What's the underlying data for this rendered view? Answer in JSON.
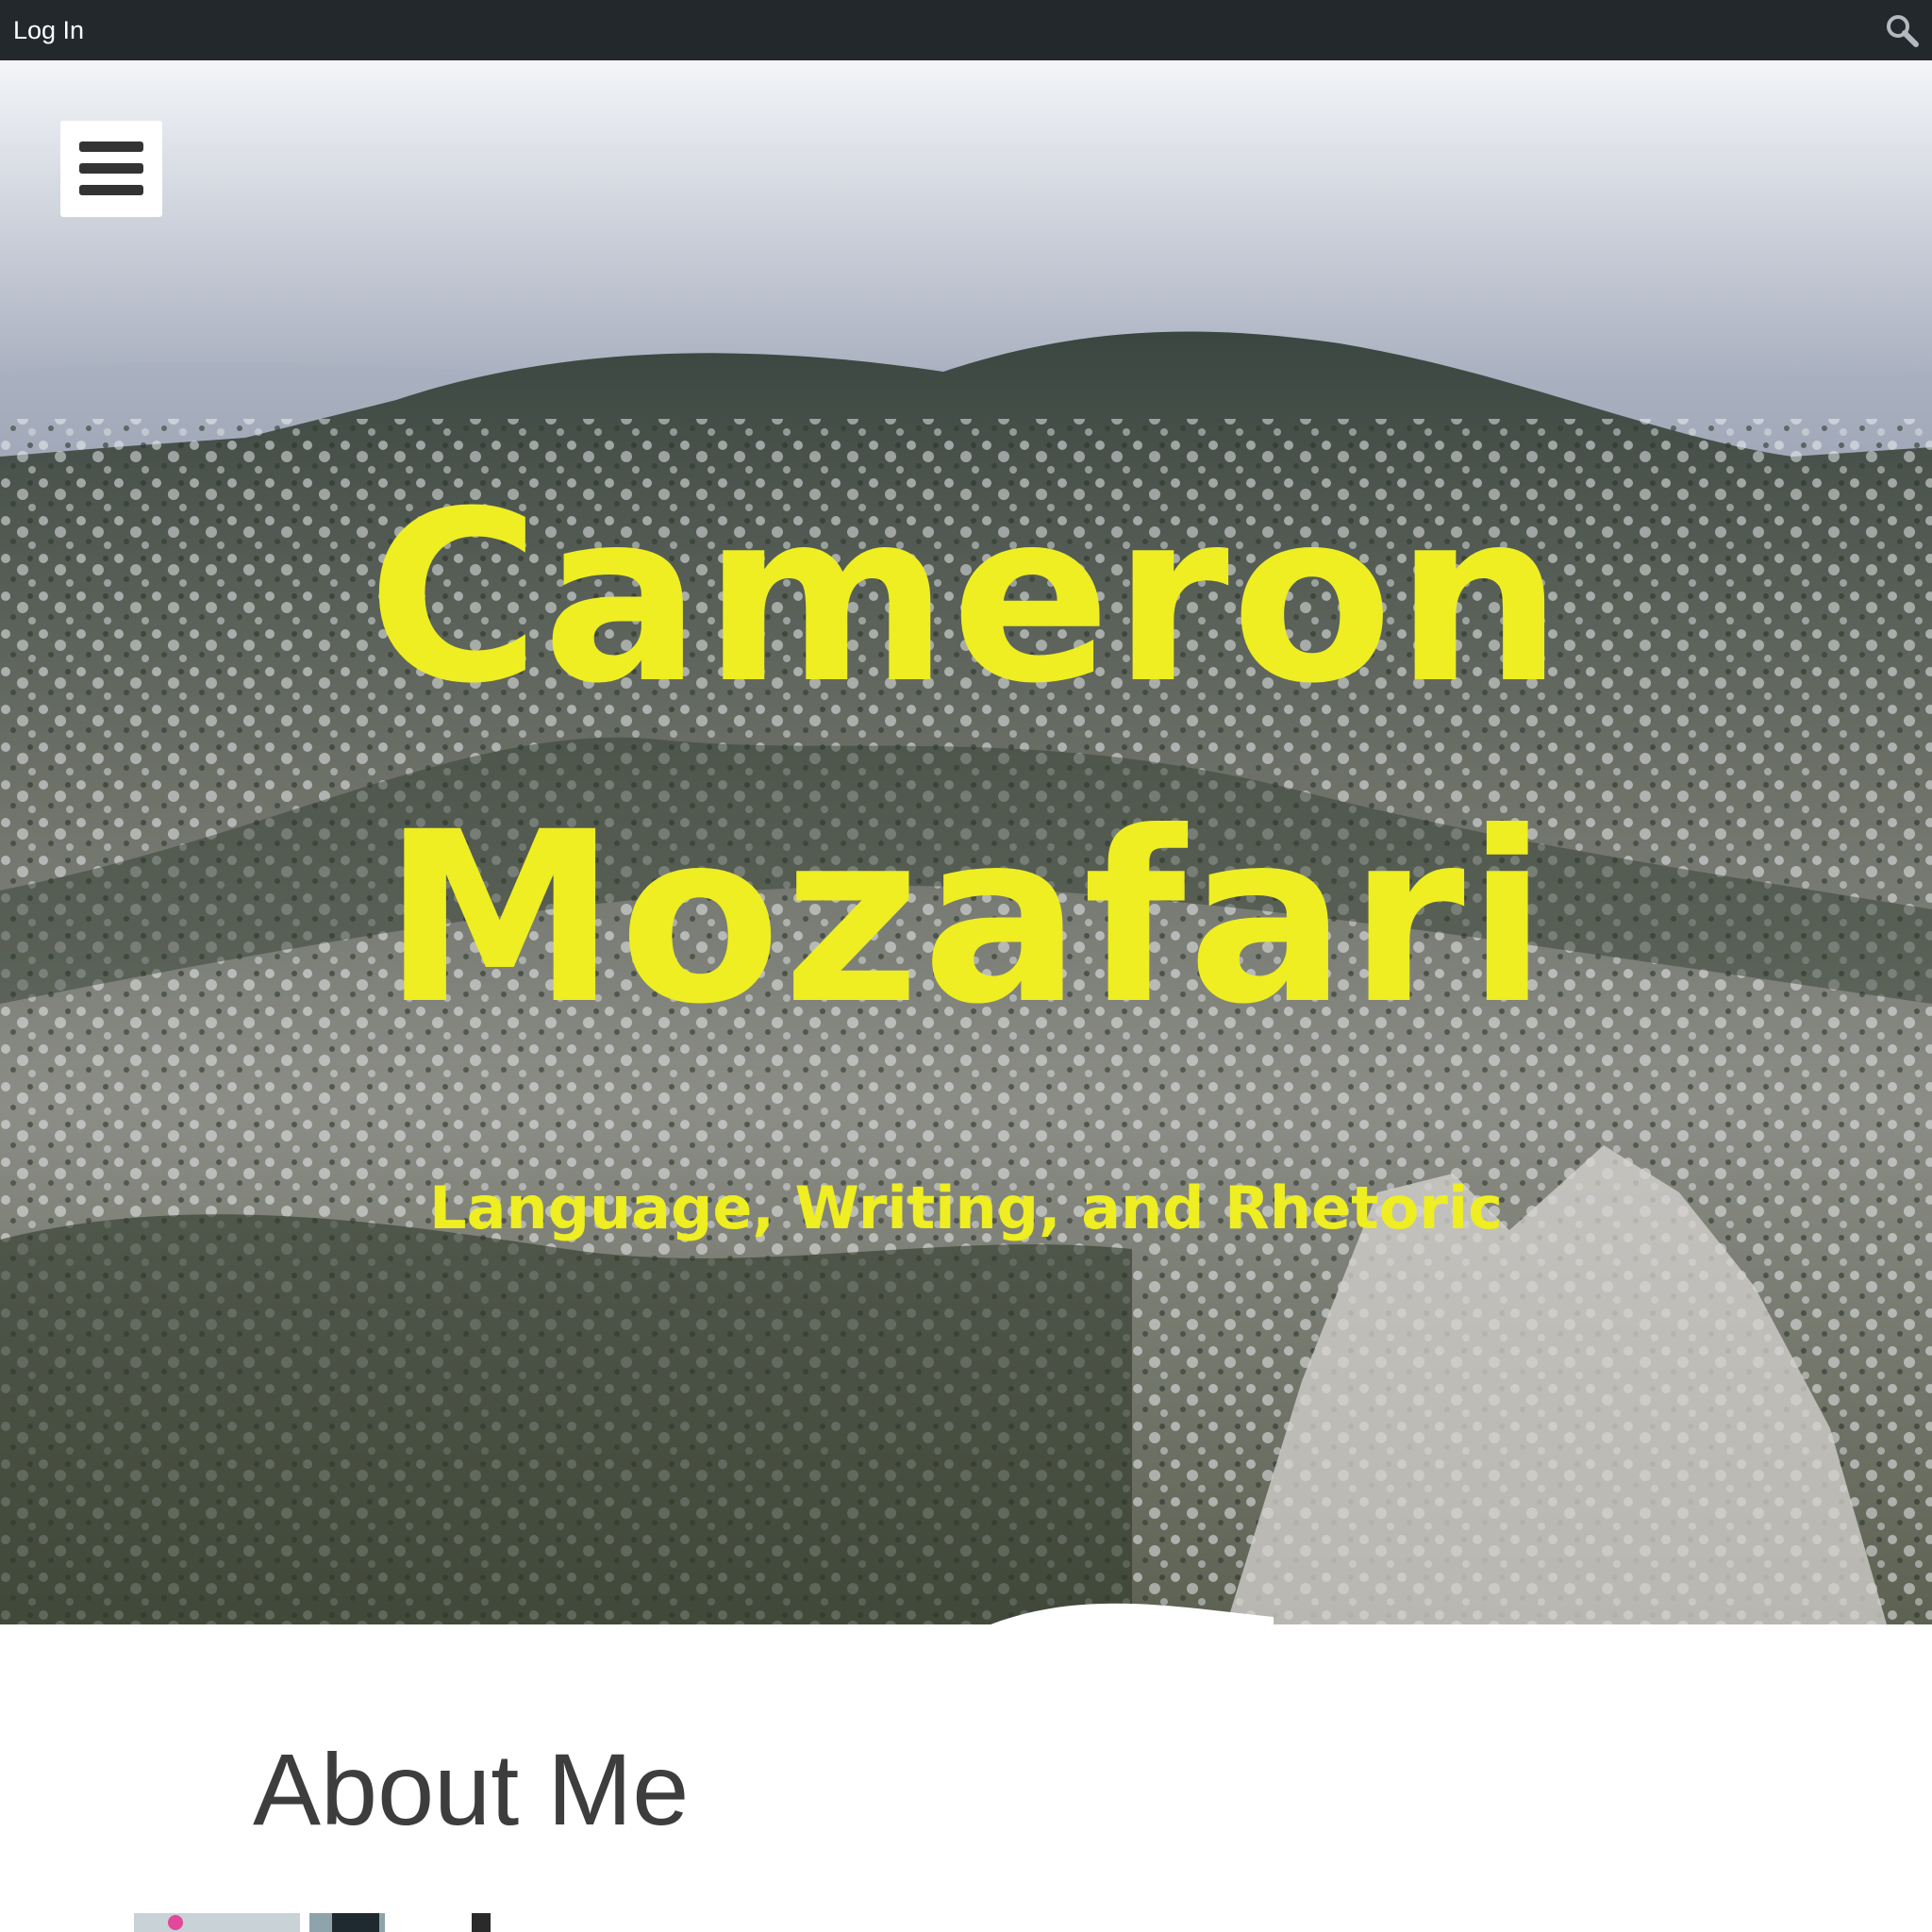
{
  "admin_bar": {
    "login_label": "Log In",
    "search_icon": "search-icon"
  },
  "hero": {
    "menu_icon": "hamburger-menu-icon",
    "title_line_1": "Cameron",
    "title_line_2": "Mozafari",
    "tagline": "Language, Writing, and Rhetoric",
    "title_color": "#eeee22"
  },
  "main": {
    "heading": "About Me"
  },
  "colors": {
    "admin_bar_bg": "#23282d",
    "heading_text": "#3d3d3d"
  }
}
